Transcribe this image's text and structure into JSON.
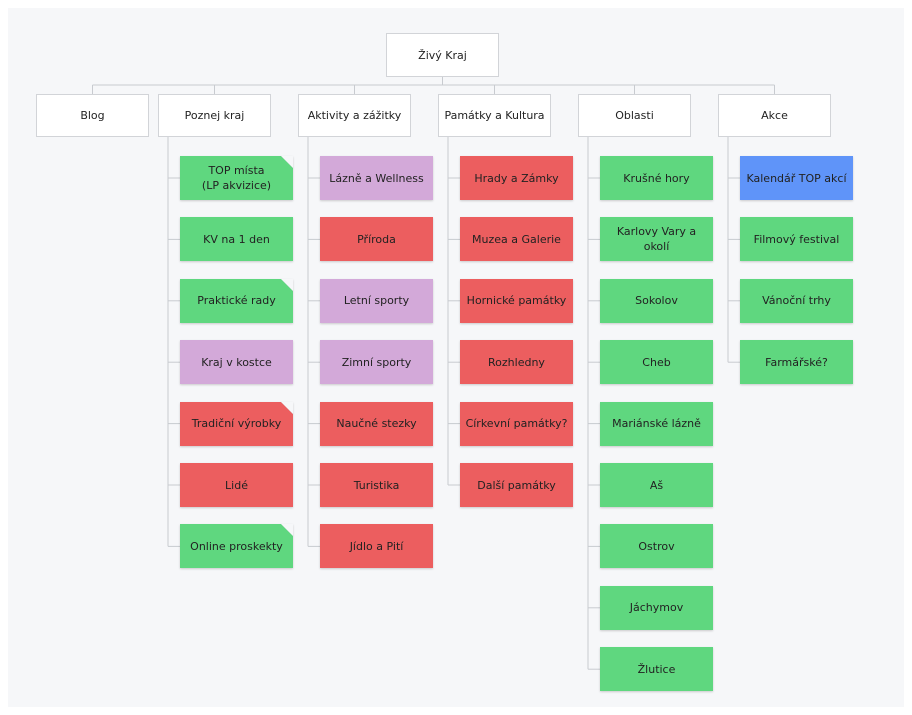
{
  "root": {
    "label": "Živý Kraj"
  },
  "columns": [
    {
      "name": "blog",
      "header": "Blog",
      "items": []
    },
    {
      "name": "poznej-kraj",
      "header": "Poznej kraj",
      "items": [
        {
          "label": "TOP místa\n(LP akvizice)",
          "color": "green",
          "folded": true
        },
        {
          "label": "KV na 1 den",
          "color": "green",
          "folded": false
        },
        {
          "label": "Praktické rady",
          "color": "green",
          "folded": true
        },
        {
          "label": "Kraj v kostce",
          "color": "purple",
          "folded": false
        },
        {
          "label": "Tradiční výrobky",
          "color": "red",
          "folded": true
        },
        {
          "label": "Lidé",
          "color": "red",
          "folded": false
        },
        {
          "label": "Online proskekty",
          "color": "green",
          "folded": true
        }
      ]
    },
    {
      "name": "aktivity",
      "header": "Aktivity a zážitky",
      "items": [
        {
          "label": "Lázně a Wellness",
          "color": "purple",
          "folded": false
        },
        {
          "label": "Příroda",
          "color": "red",
          "folded": false
        },
        {
          "label": "Letní sporty",
          "color": "purple",
          "folded": false
        },
        {
          "label": "Zimní sporty",
          "color": "purple",
          "folded": false
        },
        {
          "label": "Naučné stezky",
          "color": "red",
          "folded": false
        },
        {
          "label": "Turistika",
          "color": "red",
          "folded": false
        },
        {
          "label": "Jídlo a Pití",
          "color": "red",
          "folded": false
        }
      ]
    },
    {
      "name": "pamatky",
      "header": "Památky a Kultura",
      "items": [
        {
          "label": "Hrady a Zámky",
          "color": "red",
          "folded": false
        },
        {
          "label": "Muzea a Galerie",
          "color": "red",
          "folded": false
        },
        {
          "label": "Hornické památky",
          "color": "red",
          "folded": false
        },
        {
          "label": "Rozhledny",
          "color": "red",
          "folded": false
        },
        {
          "label": "Církevní památky?",
          "color": "red",
          "folded": false
        },
        {
          "label": "Další památky",
          "color": "red",
          "folded": false
        }
      ]
    },
    {
      "name": "oblasti",
      "header": "Oblasti",
      "items": [
        {
          "label": "Krušné hory",
          "color": "green",
          "folded": false
        },
        {
          "label": "Karlovy Vary a okolí",
          "color": "green",
          "folded": false
        },
        {
          "label": "Sokolov",
          "color": "green",
          "folded": false
        },
        {
          "label": "Cheb",
          "color": "green",
          "folded": false
        },
        {
          "label": "Mariánské lázně",
          "color": "green",
          "folded": false
        },
        {
          "label": "Aš",
          "color": "green",
          "folded": false
        },
        {
          "label": "Ostrov",
          "color": "green",
          "folded": false
        },
        {
          "label": "Jáchymov",
          "color": "green",
          "folded": false
        },
        {
          "label": "Žlutice",
          "color": "green",
          "folded": false
        }
      ]
    },
    {
      "name": "akce",
      "header": "Akce",
      "items": [
        {
          "label": "Kalendář TOP akcí",
          "color": "blue",
          "folded": false
        },
        {
          "label": "Filmový festival",
          "color": "green",
          "folded": false
        },
        {
          "label": "Vánoční trhy",
          "color": "green",
          "folded": false
        },
        {
          "label": "Farmářské?",
          "color": "green",
          "folded": false
        }
      ]
    }
  ],
  "colors": {
    "green": "#5fd77f",
    "red": "#ec5e5f",
    "purple": "#d3a9d9",
    "blue": "#5f94f9",
    "connector": "#c8cbd0"
  }
}
